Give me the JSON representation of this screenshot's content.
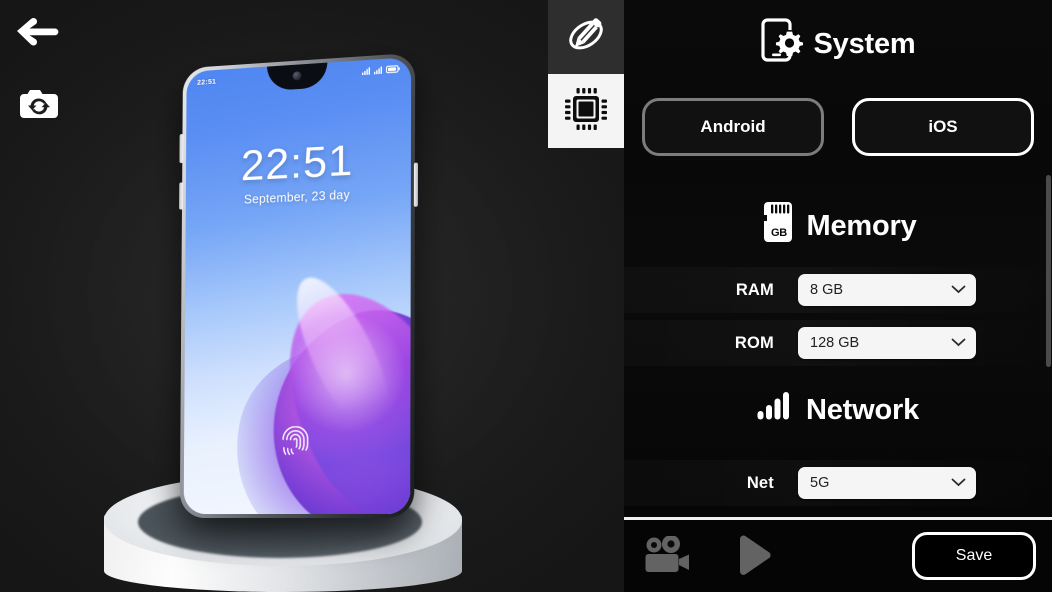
{
  "viewport": {
    "back_icon": "back-arrow-icon",
    "reset_camera_icon": "camera-reset-icon",
    "phone": {
      "status_time": "22:51",
      "status_icons": [
        "signal-icon",
        "signal-icon",
        "battery-icon"
      ],
      "lock_time": "22:51",
      "lock_date": "September, 23 day",
      "fingerprint_icon": "fingerprint-icon",
      "notch_camera_icon": "front-camera-icon"
    }
  },
  "tabs": [
    {
      "name": "design-tab",
      "icon": "pencil-orbit-icon",
      "active": false
    },
    {
      "name": "hardware-tab",
      "icon": "cpu-chip-icon",
      "active": true
    }
  ],
  "panel": {
    "sections": [
      {
        "id": "system",
        "title": "System",
        "icon": "phone-gear-icon",
        "options": [
          {
            "label": "Android",
            "selected": false
          },
          {
            "label": "iOS",
            "selected": true
          }
        ]
      },
      {
        "id": "memory",
        "title": "Memory",
        "icon": "sd-card-icon",
        "icon_text": "GB",
        "fields": [
          {
            "label": "RAM",
            "value": "8 GB"
          },
          {
            "label": "ROM",
            "value": "128 GB"
          }
        ]
      },
      {
        "id": "network",
        "title": "Network",
        "icon": "signal-bars-icon",
        "fields": [
          {
            "label": "Net",
            "value": "5G"
          }
        ]
      }
    ],
    "scrollbar": {
      "visible": true
    }
  },
  "bottom_bar": {
    "record_icon": "video-camera-icon",
    "play_icon": "play-icon",
    "save_label": "Save"
  },
  "colors": {
    "panel_background": "#070707",
    "viewport_background": "#1d1d1d",
    "accent_white": "#ffffff",
    "unselected_border": "#7c7c7c",
    "select_background": "#f5f5f5",
    "select_text": "#222222",
    "icon_muted": "#636363",
    "scrollbar": "#4b4b4b"
  }
}
